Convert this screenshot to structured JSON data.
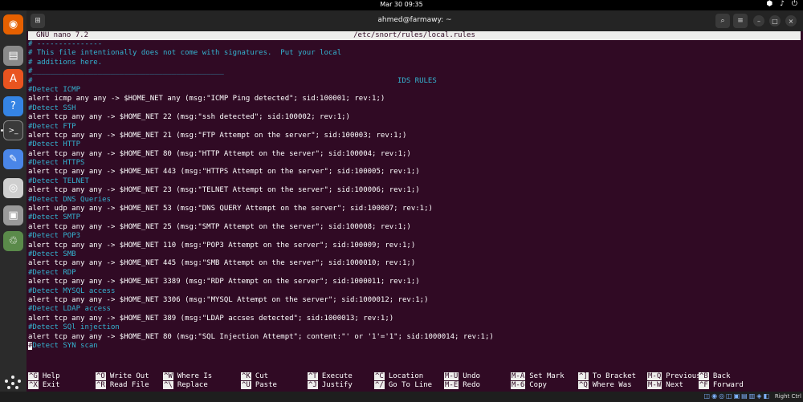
{
  "topbar": {
    "clock": "Mar 30  09:35",
    "sys_icons": "⬢ ♪ ⏻"
  },
  "dock": {
    "items": [
      {
        "name": "firefox-icon",
        "glyph": "◉",
        "color": "#e66000"
      },
      {
        "name": "files-icon",
        "glyph": "▤",
        "color": "#8a8a8a"
      },
      {
        "name": "app-center-icon",
        "glyph": "A",
        "color": "#e95420"
      },
      {
        "name": "help-icon",
        "glyph": "?",
        "color": "#3584e4"
      },
      {
        "name": "terminal-icon",
        "glyph": ">_",
        "color": "#3a3a3a"
      },
      {
        "name": "text-editor-icon",
        "glyph": "✎",
        "color": "#4a86e8"
      },
      {
        "name": "disc-icon",
        "glyph": "◎",
        "color": "#cfcfcf"
      },
      {
        "name": "drive-icon",
        "glyph": "▣",
        "color": "#9a9a9a"
      },
      {
        "name": "trash-icon",
        "glyph": "♲",
        "color": "#5a8a4a"
      }
    ]
  },
  "window": {
    "title": "ahmed@farmawy: ~",
    "nano_version": "GNU nano 7.2",
    "file_path": "/etc/snort/rules/local.rules"
  },
  "lines": [
    {
      "type": "comment",
      "text": "# ---------------"
    },
    {
      "type": "comment",
      "text": "# This file intentionally does not come with signatures.  Put your local"
    },
    {
      "type": "comment",
      "text": "# additions here."
    },
    {
      "type": "comment",
      "text": "#____________________________________________"
    },
    {
      "type": "header",
      "text": "#",
      "right": "IDS RULES"
    },
    {
      "type": "comment",
      "text": "#Detect ICMP"
    },
    {
      "type": "cmd",
      "text": "alert icmp any any -> $HOME_NET any (msg:\"ICMP Ping detected\"; sid:100001; rev:1;)"
    },
    {
      "type": "comment",
      "text": "#Detect SSH"
    },
    {
      "type": "cmd",
      "text": "alert tcp any any -> $HOME_NET 22 (msg:\"ssh detected\"; sid:100002; rev:1;)"
    },
    {
      "type": "comment",
      "text": "#Detect FTP"
    },
    {
      "type": "cmd",
      "text": "alert tcp any any -> $HOME_NET 21 (msg:\"FTP Attempt on the server\"; sid:100003; rev:1;)"
    },
    {
      "type": "comment",
      "text": "#Detect HTTP"
    },
    {
      "type": "cmd",
      "text": "alert tcp any any -> $HOME_NET 80 (msg:\"HTTP Attempt on the server\"; sid:100004; rev:1;)"
    },
    {
      "type": "comment",
      "text": "#Detect HTTPS"
    },
    {
      "type": "cmd",
      "text": "alert tcp any any -> $HOME_NET 443 (msg:\"HTTPS Attempt on the server\"; sid:100005; rev:1;)"
    },
    {
      "type": "comment",
      "text": "#Detect TELNET"
    },
    {
      "type": "cmd",
      "text": "alert tcp any any -> $HOME_NET 23 (msg:\"TELNET Attempt on the server\"; sid:100006; rev:1;)"
    },
    {
      "type": "comment",
      "text": "#Detect DNS Queries"
    },
    {
      "type": "cmd",
      "text": "alert udp any any -> $HOME_NET 53 (msg:\"DNS QUERY Attempt on the server\"; sid:100007; rev:1;)"
    },
    {
      "type": "comment",
      "text": "#Detect SMTP"
    },
    {
      "type": "cmd",
      "text": "alert tcp any any -> $HOME_NET 25 (msg:\"SMTP Attempt on the server\"; sid:100008; rev:1;)"
    },
    {
      "type": "comment",
      "text": "#Detect POP3"
    },
    {
      "type": "cmd",
      "text": "alert tcp any any -> $HOME_NET 110 (msg:\"POP3 Attempt on the server\"; sid:100009; rev:1;)"
    },
    {
      "type": "comment",
      "text": "#Detect SMB"
    },
    {
      "type": "cmd",
      "text": "alert tcp any any -> $HOME_NET 445 (msg:\"SMB Attempt on the server\"; sid:1000010; rev:1;)"
    },
    {
      "type": "comment",
      "text": "#Detect RDP"
    },
    {
      "type": "cmd",
      "text": "alert tcp any any -> $HOME_NET 3389 (msg:\"RDP Attempt on the server\"; sid:1000011; rev:1;)"
    },
    {
      "type": "comment",
      "text": "#Detect MYSQL access"
    },
    {
      "type": "cmd",
      "text": "alert tcp any any -> $HOME_NET 3306 (msg:\"MYSQL Attempt on the server\"; sid:1000012; rev:1;)"
    },
    {
      "type": "comment",
      "text": "#Detect LDAP access"
    },
    {
      "type": "cmd",
      "text": "alert tcp any any -> $HOME_NET 389 (msg:\"LDAP accses detected\"; sid:1000013; rev:1;)"
    },
    {
      "type": "comment",
      "text": "#Detect SQl injection"
    },
    {
      "type": "cmd",
      "text": "alert tcp any any -> $HOME_NET 80 (msg:\"SQL Injection Attempt\"; content:\"' or '1'='1\"; sid:1000014; rev:1;)"
    },
    {
      "type": "cursor",
      "cursor_char": "#",
      "text": "Detect SYN scan"
    }
  ],
  "shortcuts": [
    [
      {
        "k": "^G",
        "l": "Help"
      },
      {
        "k": "^X",
        "l": "Exit"
      }
    ],
    [
      {
        "k": "^O",
        "l": "Write Out"
      },
      {
        "k": "^R",
        "l": "Read File"
      }
    ],
    [
      {
        "k": "^W",
        "l": "Where Is"
      },
      {
        "k": "^\\",
        "l": "Replace"
      }
    ],
    [
      {
        "k": "^K",
        "l": "Cut"
      },
      {
        "k": "^U",
        "l": "Paste"
      }
    ],
    [
      {
        "k": "^T",
        "l": "Execute"
      },
      {
        "k": "^J",
        "l": "Justify"
      }
    ],
    [
      {
        "k": "^C",
        "l": "Location"
      },
      {
        "k": "^/",
        "l": "Go To Line"
      }
    ],
    [
      {
        "k": "M-U",
        "l": "Undo"
      },
      {
        "k": "M-E",
        "l": "Redo"
      }
    ],
    [
      {
        "k": "M-A",
        "l": "Set Mark"
      },
      {
        "k": "M-6",
        "l": "Copy"
      }
    ],
    [
      {
        "k": "^]",
        "l": "To Bracket"
      },
      {
        "k": "^Q",
        "l": "Where Was"
      }
    ],
    [
      {
        "k": "M-Q",
        "l": "Previous"
      },
      {
        "k": "M-W",
        "l": "Next"
      }
    ],
    [
      {
        "k": "^B",
        "l": "Back"
      },
      {
        "k": "^F",
        "l": "Forward"
      }
    ]
  ],
  "vbox": {
    "right_ctrl": "Right Ctrl"
  },
  "colors": {
    "terminal_bg": "#300a24",
    "comment": "#34b2cf"
  }
}
